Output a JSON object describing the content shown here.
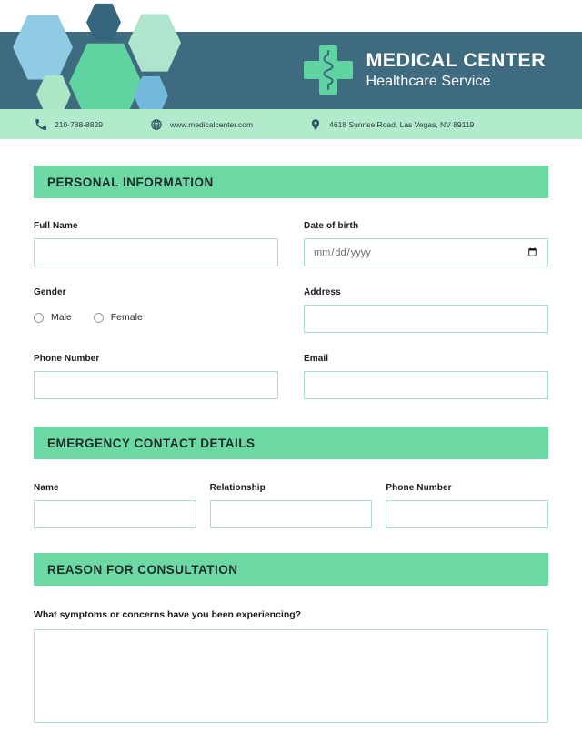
{
  "header": {
    "brand_title": "MEDICAL CENTER",
    "brand_subtitle": "Healthcare Service",
    "logo_icon": "medical-cross-caduceus-icon",
    "colors": {
      "band": "#3F6B80",
      "contact_band": "#B2EBCB",
      "accent_green": "#5FD3A0",
      "section_bar": "#6CD9A4",
      "input_border": "#A8DFC8"
    },
    "decor_hexagons": [
      {
        "color": "#8FCBE3"
      },
      {
        "color": "#36657F"
      },
      {
        "color": "#AFE5CD"
      },
      {
        "color": "#5FD3A0"
      },
      {
        "color": "#ADE6C6"
      },
      {
        "color": "#73B9DC"
      }
    ],
    "contact": [
      {
        "icon": "phone-icon",
        "text": "210-788-8829"
      },
      {
        "icon": "globe-icon",
        "text": "www.medicalcenter.com"
      },
      {
        "icon": "location-pin-icon",
        "text": "4618 Sunrise Road, Las Vegas, NV 89119"
      }
    ]
  },
  "sections": {
    "personal": {
      "title": "PERSONAL INFORMATION",
      "full_name": {
        "label": "Full Name",
        "value": "",
        "placeholder": ""
      },
      "date_of_birth": {
        "label": "Date of birth",
        "value": "",
        "placeholder": "mm/dd/yyyy"
      },
      "gender": {
        "label": "Gender",
        "options": [
          {
            "label": "Male",
            "selected": false
          },
          {
            "label": "Female",
            "selected": false
          }
        ]
      },
      "address": {
        "label": "Address",
        "value": "",
        "placeholder": ""
      },
      "phone_number": {
        "label": "Phone Number",
        "value": "",
        "placeholder": ""
      },
      "email": {
        "label": "Email",
        "value": "",
        "placeholder": ""
      }
    },
    "emergency": {
      "title": "EMERGENCY CONTACT DETAILS",
      "name": {
        "label": "Name",
        "value": "",
        "placeholder": ""
      },
      "relationship": {
        "label": "Relationship",
        "value": "",
        "placeholder": ""
      },
      "phone_number": {
        "label": "Phone Number",
        "value": "",
        "placeholder": ""
      }
    },
    "reason": {
      "title": "REASON FOR CONSULTATION",
      "question": "What symptoms or concerns have you been experiencing?",
      "answer": {
        "value": "",
        "placeholder": ""
      }
    }
  }
}
